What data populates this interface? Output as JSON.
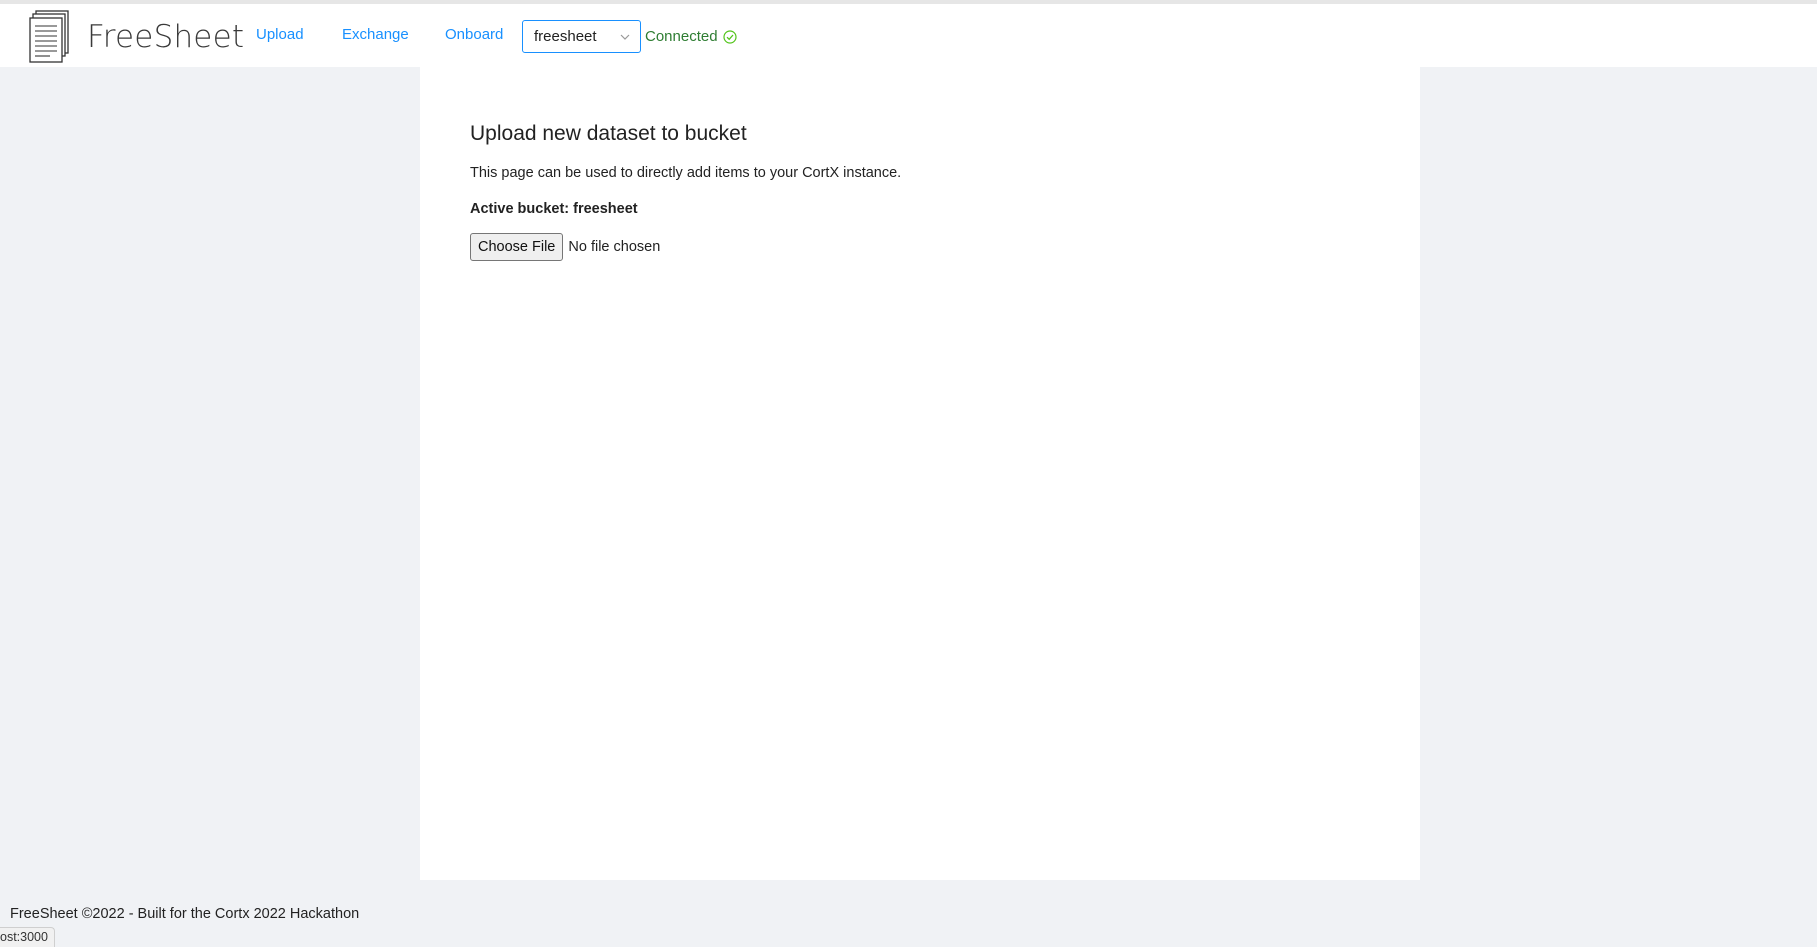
{
  "app": {
    "brand": "FreeSheet"
  },
  "nav": {
    "items": [
      {
        "label": "Upload"
      },
      {
        "label": "Exchange"
      },
      {
        "label": "Onboard"
      }
    ]
  },
  "bucket_select": {
    "selected": "freesheet"
  },
  "connection": {
    "status_text": "Connected",
    "status_color": "#2e7d32",
    "icon": "check-circle-icon"
  },
  "main": {
    "title": "Upload new dataset to bucket",
    "description": "This page can be used to directly add items to your CortX instance.",
    "active_bucket": "Active bucket: freesheet",
    "file_input": {
      "button_label": "Choose File",
      "status": "No file chosen"
    }
  },
  "footer": {
    "text": "FreeSheet ©2022 - Built for the Cortx 2022 Hackathon"
  },
  "status_bar": {
    "url": "ost:3000"
  },
  "colors": {
    "accent": "#1890ff",
    "background": "#f0f2f5",
    "surface": "#ffffff"
  }
}
